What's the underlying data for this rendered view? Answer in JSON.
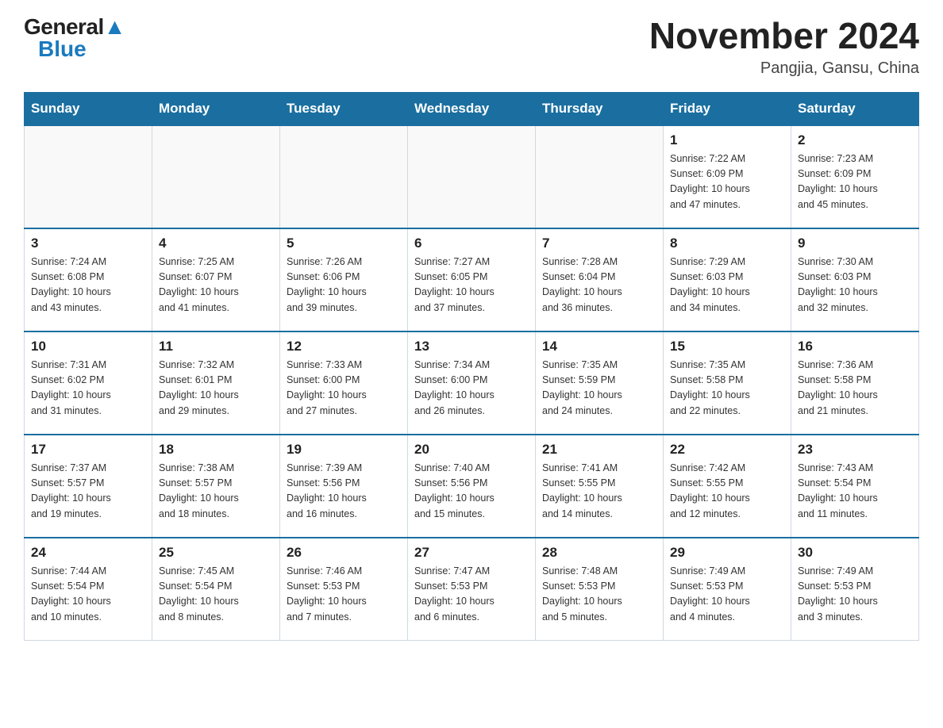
{
  "header": {
    "logo_general": "General",
    "logo_blue": "Blue",
    "title": "November 2024",
    "subtitle": "Pangjia, Gansu, China"
  },
  "weekdays": [
    "Sunday",
    "Monday",
    "Tuesday",
    "Wednesday",
    "Thursday",
    "Friday",
    "Saturday"
  ],
  "weeks": [
    [
      {
        "day": "",
        "info": ""
      },
      {
        "day": "",
        "info": ""
      },
      {
        "day": "",
        "info": ""
      },
      {
        "day": "",
        "info": ""
      },
      {
        "day": "",
        "info": ""
      },
      {
        "day": "1",
        "info": "Sunrise: 7:22 AM\nSunset: 6:09 PM\nDaylight: 10 hours\nand 47 minutes."
      },
      {
        "day": "2",
        "info": "Sunrise: 7:23 AM\nSunset: 6:09 PM\nDaylight: 10 hours\nand 45 minutes."
      }
    ],
    [
      {
        "day": "3",
        "info": "Sunrise: 7:24 AM\nSunset: 6:08 PM\nDaylight: 10 hours\nand 43 minutes."
      },
      {
        "day": "4",
        "info": "Sunrise: 7:25 AM\nSunset: 6:07 PM\nDaylight: 10 hours\nand 41 minutes."
      },
      {
        "day": "5",
        "info": "Sunrise: 7:26 AM\nSunset: 6:06 PM\nDaylight: 10 hours\nand 39 minutes."
      },
      {
        "day": "6",
        "info": "Sunrise: 7:27 AM\nSunset: 6:05 PM\nDaylight: 10 hours\nand 37 minutes."
      },
      {
        "day": "7",
        "info": "Sunrise: 7:28 AM\nSunset: 6:04 PM\nDaylight: 10 hours\nand 36 minutes."
      },
      {
        "day": "8",
        "info": "Sunrise: 7:29 AM\nSunset: 6:03 PM\nDaylight: 10 hours\nand 34 minutes."
      },
      {
        "day": "9",
        "info": "Sunrise: 7:30 AM\nSunset: 6:03 PM\nDaylight: 10 hours\nand 32 minutes."
      }
    ],
    [
      {
        "day": "10",
        "info": "Sunrise: 7:31 AM\nSunset: 6:02 PM\nDaylight: 10 hours\nand 31 minutes."
      },
      {
        "day": "11",
        "info": "Sunrise: 7:32 AM\nSunset: 6:01 PM\nDaylight: 10 hours\nand 29 minutes."
      },
      {
        "day": "12",
        "info": "Sunrise: 7:33 AM\nSunset: 6:00 PM\nDaylight: 10 hours\nand 27 minutes."
      },
      {
        "day": "13",
        "info": "Sunrise: 7:34 AM\nSunset: 6:00 PM\nDaylight: 10 hours\nand 26 minutes."
      },
      {
        "day": "14",
        "info": "Sunrise: 7:35 AM\nSunset: 5:59 PM\nDaylight: 10 hours\nand 24 minutes."
      },
      {
        "day": "15",
        "info": "Sunrise: 7:35 AM\nSunset: 5:58 PM\nDaylight: 10 hours\nand 22 minutes."
      },
      {
        "day": "16",
        "info": "Sunrise: 7:36 AM\nSunset: 5:58 PM\nDaylight: 10 hours\nand 21 minutes."
      }
    ],
    [
      {
        "day": "17",
        "info": "Sunrise: 7:37 AM\nSunset: 5:57 PM\nDaylight: 10 hours\nand 19 minutes."
      },
      {
        "day": "18",
        "info": "Sunrise: 7:38 AM\nSunset: 5:57 PM\nDaylight: 10 hours\nand 18 minutes."
      },
      {
        "day": "19",
        "info": "Sunrise: 7:39 AM\nSunset: 5:56 PM\nDaylight: 10 hours\nand 16 minutes."
      },
      {
        "day": "20",
        "info": "Sunrise: 7:40 AM\nSunset: 5:56 PM\nDaylight: 10 hours\nand 15 minutes."
      },
      {
        "day": "21",
        "info": "Sunrise: 7:41 AM\nSunset: 5:55 PM\nDaylight: 10 hours\nand 14 minutes."
      },
      {
        "day": "22",
        "info": "Sunrise: 7:42 AM\nSunset: 5:55 PM\nDaylight: 10 hours\nand 12 minutes."
      },
      {
        "day": "23",
        "info": "Sunrise: 7:43 AM\nSunset: 5:54 PM\nDaylight: 10 hours\nand 11 minutes."
      }
    ],
    [
      {
        "day": "24",
        "info": "Sunrise: 7:44 AM\nSunset: 5:54 PM\nDaylight: 10 hours\nand 10 minutes."
      },
      {
        "day": "25",
        "info": "Sunrise: 7:45 AM\nSunset: 5:54 PM\nDaylight: 10 hours\nand 8 minutes."
      },
      {
        "day": "26",
        "info": "Sunrise: 7:46 AM\nSunset: 5:53 PM\nDaylight: 10 hours\nand 7 minutes."
      },
      {
        "day": "27",
        "info": "Sunrise: 7:47 AM\nSunset: 5:53 PM\nDaylight: 10 hours\nand 6 minutes."
      },
      {
        "day": "28",
        "info": "Sunrise: 7:48 AM\nSunset: 5:53 PM\nDaylight: 10 hours\nand 5 minutes."
      },
      {
        "day": "29",
        "info": "Sunrise: 7:49 AM\nSunset: 5:53 PM\nDaylight: 10 hours\nand 4 minutes."
      },
      {
        "day": "30",
        "info": "Sunrise: 7:49 AM\nSunset: 5:53 PM\nDaylight: 10 hours\nand 3 minutes."
      }
    ]
  ]
}
